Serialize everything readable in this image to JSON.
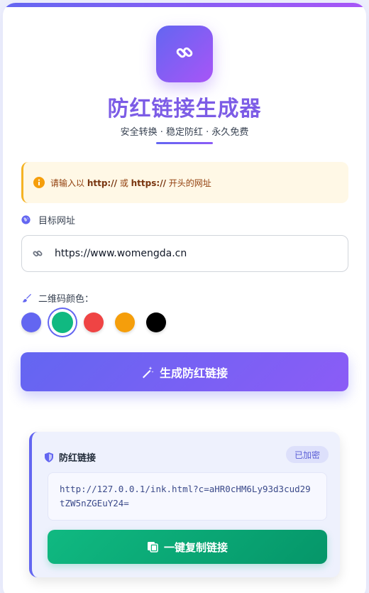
{
  "header": {
    "title": "防红链接生成器",
    "subtitle": "安全转换 · 稳定防红 · 永久免费"
  },
  "notice": {
    "prefix": "请输入以 ",
    "proto1": "http://",
    "middle": " 或 ",
    "proto2": "https://",
    "suffix": " 开头的网址"
  },
  "form": {
    "url_label": "目标网址",
    "url_value": "https://www.womengda.cn",
    "color_label": "二维码颜色：",
    "colors": [
      "#6366f1",
      "#10b981",
      "#ef4444",
      "#f59e0b",
      "#000000"
    ],
    "selected_color_index": 1,
    "generate_label": "生成防红链接"
  },
  "result": {
    "title": "防红链接",
    "badge": "已加密",
    "link": "http://127.0.0.1/ink.html?c=aHR0cHM6Ly93d3cud29tZW5nZGEuY24=",
    "copy_label": "一键复制链接"
  },
  "icons": {
    "logo": "link-icon",
    "notice": "info-icon",
    "url_label": "globe-icon",
    "url_field": "link-icon",
    "color_label": "paint-brush-icon",
    "generate": "magic-wand-icon",
    "result": "shield-icon",
    "copy": "copy-icon"
  }
}
